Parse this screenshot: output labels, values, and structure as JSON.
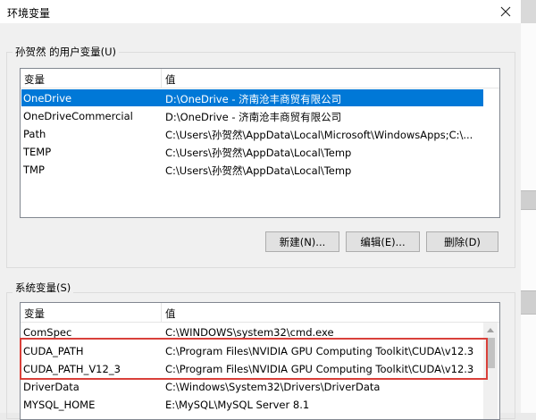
{
  "window": {
    "title": "环境变量",
    "close_icon": "close-icon"
  },
  "user_section": {
    "legend": "孙贺然 的用户变量(U)",
    "columns": [
      "变量",
      "值"
    ],
    "rows": [
      {
        "name": "OneDrive",
        "value": "D:\\OneDrive - 济南沧丰商贸有限公司",
        "selected": true
      },
      {
        "name": "OneDriveCommercial",
        "value": "D:\\OneDrive - 济南沧丰商贸有限公司"
      },
      {
        "name": "Path",
        "value": "C:\\Users\\孙贺然\\AppData\\Local\\Microsoft\\WindowsApps;C:\\..."
      },
      {
        "name": "TEMP",
        "value": "C:\\Users\\孙贺然\\AppData\\Local\\Temp"
      },
      {
        "name": "TMP",
        "value": "C:\\Users\\孙贺然\\AppData\\Local\\Temp"
      }
    ],
    "buttons": {
      "new": "新建(N)...",
      "edit": "编辑(E)...",
      "delete": "删除(D)"
    }
  },
  "system_section": {
    "legend": "系统变量(S)",
    "columns": [
      "变量",
      "值"
    ],
    "rows": [
      {
        "name": "ComSpec",
        "value": "C:\\WINDOWS\\system32\\cmd.exe"
      },
      {
        "name": "CUDA_PATH",
        "value": "C:\\Program Files\\NVIDIA GPU Computing Toolkit\\CUDA\\v12.3",
        "highlighted": true
      },
      {
        "name": "CUDA_PATH_V12_3",
        "value": "C:\\Program Files\\NVIDIA GPU Computing Toolkit\\CUDA\\v12.3",
        "highlighted": true
      },
      {
        "name": "DriverData",
        "value": "C:\\Windows\\System32\\Drivers\\DriverData"
      },
      {
        "name": "MYSQL_HOME",
        "value": "E:\\MySQL\\MySQL Server 8.1"
      }
    ]
  },
  "colors": {
    "selection": "#0078d7",
    "highlight_box": "#d9403a",
    "dialog_bg": "#f0f0f0"
  }
}
